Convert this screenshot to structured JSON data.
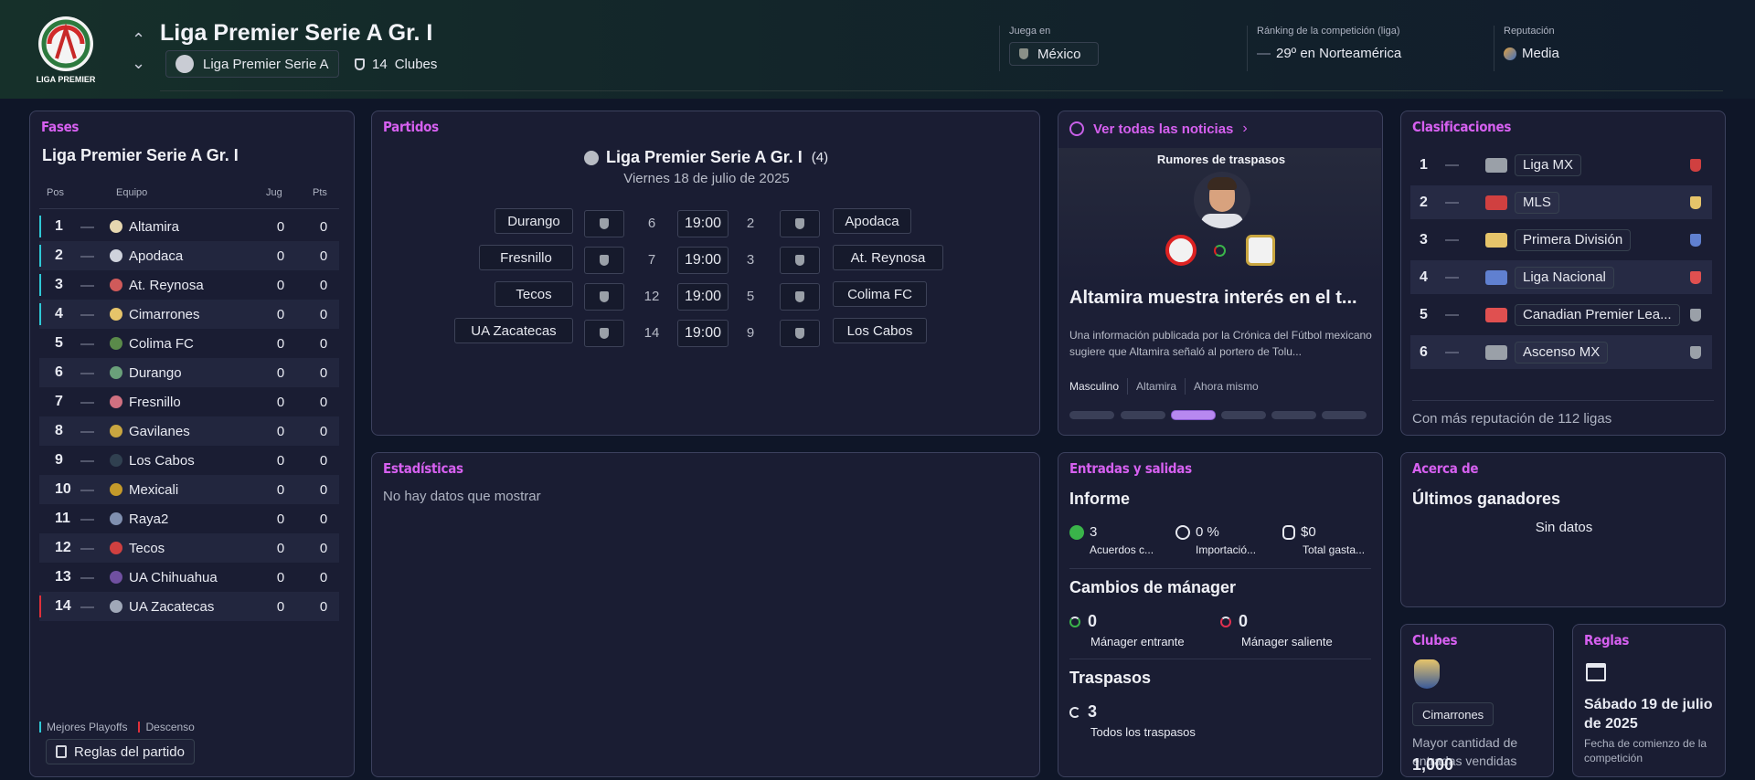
{
  "header": {
    "title": "Liga Premier Serie A Gr. I",
    "logo_text": "LIGA PREMIER",
    "parent_league": "Liga Premier Serie A",
    "clubs_count": "14",
    "clubs_label": "Clubes",
    "plays_in_label": "Juega en",
    "plays_in_value": "México",
    "ranking_label": "Ránking de la competición (liga)",
    "ranking_value": "29º en Norteamérica",
    "reputation_label": "Reputación",
    "reputation_value": "Media"
  },
  "fases": {
    "title": "Fases",
    "subtitle": "Liga Premier Serie A Gr. I",
    "columns": {
      "pos": "Pos",
      "team": "Equipo",
      "played": "Jug",
      "points": "Pts"
    },
    "rows": [
      {
        "pos": "1",
        "team": "Altamira",
        "played": "0",
        "pts": "0",
        "mark": "playoff",
        "color": "#e6d7b0"
      },
      {
        "pos": "2",
        "team": "Apodaca",
        "played": "0",
        "pts": "0",
        "mark": "playoff",
        "color": "#cfd3dc"
      },
      {
        "pos": "3",
        "team": "At. Reynosa",
        "played": "0",
        "pts": "0",
        "mark": "playoff",
        "color": "#d05a5a"
      },
      {
        "pos": "4",
        "team": "Cimarrones",
        "played": "0",
        "pts": "0",
        "mark": "playoff",
        "color": "#e6c46a"
      },
      {
        "pos": "5",
        "team": "Colima FC",
        "played": "0",
        "pts": "0",
        "mark": "none",
        "color": "#5a8a4a"
      },
      {
        "pos": "6",
        "team": "Durango",
        "played": "0",
        "pts": "0",
        "mark": "none",
        "color": "#6aa07a"
      },
      {
        "pos": "7",
        "team": "Fresnillo",
        "played": "0",
        "pts": "0",
        "mark": "none",
        "color": "#d07080"
      },
      {
        "pos": "8",
        "team": "Gavilanes",
        "played": "0",
        "pts": "0",
        "mark": "none",
        "color": "#c9a640"
      },
      {
        "pos": "9",
        "team": "Los Cabos",
        "played": "0",
        "pts": "0",
        "mark": "none",
        "color": "#304050"
      },
      {
        "pos": "10",
        "team": "Mexicali",
        "played": "0",
        "pts": "0",
        "mark": "none",
        "color": "#c49a2a"
      },
      {
        "pos": "11",
        "team": "Raya2",
        "played": "0",
        "pts": "0",
        "mark": "none",
        "color": "#8090b0"
      },
      {
        "pos": "12",
        "team": "Tecos",
        "played": "0",
        "pts": "0",
        "mark": "none",
        "color": "#d04040"
      },
      {
        "pos": "13",
        "team": "UA Chihuahua",
        "played": "0",
        "pts": "0",
        "mark": "none",
        "color": "#7050a0"
      },
      {
        "pos": "14",
        "team": "UA Zacatecas",
        "played": "0",
        "pts": "0",
        "mark": "relegation",
        "color": "#a0a8b8"
      }
    ],
    "legend_playoff": "Mejores Playoffs",
    "legend_relegation": "Descenso",
    "rules_button": "Reglas del partido",
    "colors": {
      "playoff": "#2fc9d6",
      "relegation": "#e0303a"
    }
  },
  "partidos": {
    "title": "Partidos",
    "league": "Liga Premier Serie A Gr. I",
    "round": "(4)",
    "date": "Viernes 18 de julio de 2025",
    "matches": [
      {
        "home": "Durango",
        "home_pos": "6",
        "time": "19:00",
        "away_pos": "2",
        "away": "Apodaca"
      },
      {
        "home": "Fresnillo",
        "home_pos": "7",
        "time": "19:00",
        "away_pos": "3",
        "away": "At. Reynosa"
      },
      {
        "home": "Tecos",
        "home_pos": "12",
        "time": "19:00",
        "away_pos": "5",
        "away": "Colima FC"
      },
      {
        "home": "UA Zacatecas",
        "home_pos": "14",
        "time": "19:00",
        "away_pos": "9",
        "away": "Los Cabos"
      }
    ]
  },
  "news": {
    "link": "Ver todas las noticias",
    "rumor_label": "Rumores de traspasos",
    "headline": "Altamira muestra interés en el t...",
    "body": "Una información publicada por la Crónica del Fútbol mexicano sugiere que Altamira señaló al portero de Tolu...",
    "tags": [
      "Masculino",
      "Altamira",
      "Ahora mismo"
    ],
    "active_dot": 2
  },
  "clasificaciones": {
    "title": "Clasificaciones",
    "rows": [
      {
        "pos": "1",
        "name": "Liga MX"
      },
      {
        "pos": "2",
        "name": "MLS"
      },
      {
        "pos": "3",
        "name": "Primera División"
      },
      {
        "pos": "4",
        "name": "Liga Nacional"
      },
      {
        "pos": "5",
        "name": "Canadian Premier Lea..."
      },
      {
        "pos": "6",
        "name": "Ascenso MX"
      }
    ],
    "footer": "Con más reputación de 112 ligas"
  },
  "estadisticas": {
    "title": "Estadísticas",
    "empty": "No hay datos que mostrar"
  },
  "entradas": {
    "title": "Entradas y salidas",
    "informe": "Informe",
    "stats": [
      {
        "value": "3",
        "label": "Acuerdos c..."
      },
      {
        "value": "0 %",
        "label": "Importació..."
      },
      {
        "value": "$0",
        "label": "Total gasta..."
      }
    ],
    "manager_title": "Cambios de mánager",
    "manager_in_value": "0",
    "manager_in_label": "Mánager entrante",
    "manager_out_value": "0",
    "manager_out_label": "Mánager saliente",
    "transfers_title": "Traspasos",
    "transfers_value": "3",
    "transfers_label": "Todos los traspasos"
  },
  "acerca": {
    "title": "Acerca de",
    "subtitle": "Últimos ganadores",
    "empty": "Sin datos"
  },
  "clubes": {
    "title": "Clubes",
    "club": "Cimarrones",
    "desc": "Mayor cantidad de entradas vendidas",
    "value": "1,000"
  },
  "reglas": {
    "title": "Reglas",
    "date": "Sábado 19 de julio de 2025",
    "desc": "Fecha de comienzo de la competición"
  }
}
